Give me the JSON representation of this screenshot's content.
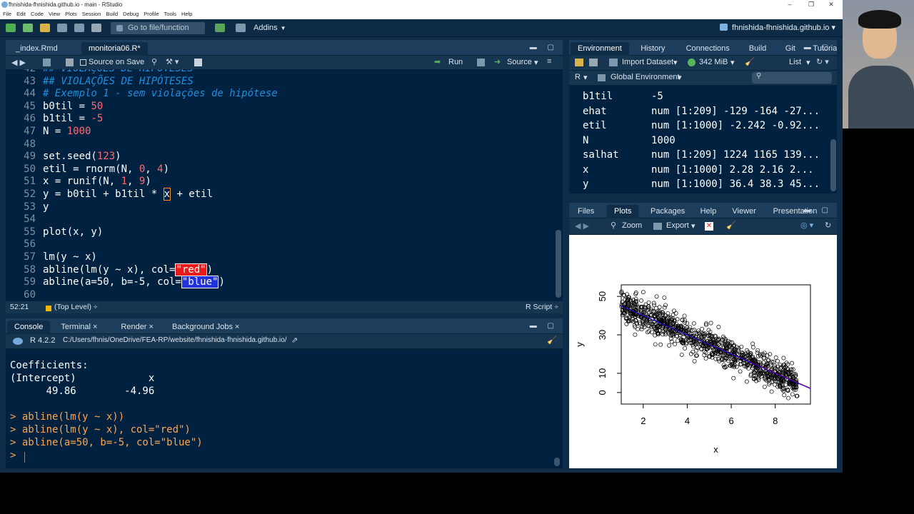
{
  "window": {
    "title": "fhnishida-fhnishida.github.io - main - RStudio",
    "project": "fhnishida-fhnishida.github.io"
  },
  "menu": [
    "File",
    "Edit",
    "Code",
    "View",
    "Plots",
    "Session",
    "Build",
    "Debug",
    "Profile",
    "Tools",
    "Help"
  ],
  "toolbar": {
    "goto": "Go to file/function",
    "addins": "Addins"
  },
  "source_tabs": [
    {
      "label": "_index.Rmd",
      "active": false
    },
    {
      "label": "monitoria06.R*",
      "active": true
    }
  ],
  "source_toolbar": {
    "source_on_save": "Source on Save",
    "run": "Run",
    "source": "Source"
  },
  "code_lines": [
    {
      "n": "42",
      "t": "## VIOLAÇÕES DE HIPÓTESES"
    },
    {
      "n": "43",
      "t": "## VIOLAÇÕES DE HIPÓTESES"
    },
    {
      "n": "44",
      "t": "# Exemplo 1 - sem violações de hipótese"
    },
    {
      "n": "45",
      "a": "b0til = ",
      "b": "50"
    },
    {
      "n": "46",
      "a": "b1til = ",
      "b": "-5"
    },
    {
      "n": "47",
      "a": "N = ",
      "b": "1000"
    },
    {
      "n": "48"
    },
    {
      "n": "49",
      "a": "set.seed(",
      "b": "123",
      "c": ")"
    },
    {
      "n": "50",
      "a": "etil = rnorm(N, ",
      "b": "0",
      "c": ", ",
      "d": "4",
      "e": ")"
    },
    {
      "n": "51",
      "a": "x = runif(N, ",
      "b": "1",
      "c": ", ",
      "d": "9",
      "e": ")"
    },
    {
      "n": "52",
      "a": "y = b0til + b1til * ",
      "x": "x",
      "c": " + etil"
    },
    {
      "n": "53",
      "a": "y"
    },
    {
      "n": "54"
    },
    {
      "n": "55",
      "a": "plot(x, y)"
    },
    {
      "n": "56"
    },
    {
      "n": "57",
      "a": "lm(y ~ x)"
    },
    {
      "n": "58",
      "a": "abline(lm(y ~ x), col=",
      "s": "\"red\"",
      "c": ")"
    },
    {
      "n": "59",
      "a": "abline(a=50, b=-5, col=",
      "s2": "\"blue\"",
      "c": ")"
    },
    {
      "n": "60"
    }
  ],
  "status": {
    "pos": "52:21",
    "scope": "(Top Level) ÷",
    "type": "R Script ÷"
  },
  "console_tabs": [
    "Console",
    "Terminal ×",
    "Render ×",
    "Background Jobs ×"
  ],
  "console_path": {
    "version": "R 4.2.2",
    "path": "C:/Users/fhnis/OneDrive/FEA-RP/website/fhnishida-fhnishida.github.io/"
  },
  "console_lines": [
    "Coefficients:",
    "(Intercept)            x  ",
    "      49.86        -4.96  ",
    "",
    "> abline(lm(y ~ x))",
    "> abline(lm(y ~ x), col=\"red\")",
    "> abline(a=50, b=-5, col=\"blue\")",
    "> "
  ],
  "env_tabs": [
    "Environment",
    "History",
    "Connections",
    "Build",
    "Git",
    "Tutorial"
  ],
  "env_toolbar": {
    "import": "Import Dataset",
    "mem": "342 MiB",
    "list": "List",
    "lang": "R",
    "scope": "Global Environment"
  },
  "env_rows": [
    {
      "name": "b1til",
      "value": "-5"
    },
    {
      "name": "ehat",
      "value": "num [1:209] -129 -164 -27..."
    },
    {
      "name": "etil",
      "value": "num [1:1000] -2.242 -0.92..."
    },
    {
      "name": "N",
      "value": "1000"
    },
    {
      "name": "salhat",
      "value": "num [1:209] 1224 1165 139..."
    },
    {
      "name": "x",
      "value": "num [1:1000] 2.28 2.16 2..."
    },
    {
      "name": "y",
      "value": "num [1:1000] 36.4 38.3 45..."
    }
  ],
  "plot_tabs": [
    "Files",
    "Plots",
    "Packages",
    "Help",
    "Viewer",
    "Presentation"
  ],
  "plot_toolbar": {
    "zoom": "Zoom",
    "export": "Export"
  },
  "chart_data": {
    "type": "scatter",
    "xlabel": "x",
    "ylabel": "y",
    "xlim": [
      1,
      9.6
    ],
    "ylim": [
      -6,
      56
    ],
    "xticks": [
      2,
      4,
      6,
      8
    ],
    "yticks": [
      0,
      10,
      30,
      50
    ],
    "n_points": 1000,
    "model": {
      "intercept": 50,
      "slope": -5,
      "noise_sd": 4,
      "x_min": 1,
      "x_max": 9
    },
    "lines": [
      {
        "intercept": 49.86,
        "slope": -4.96,
        "color": "#000000"
      },
      {
        "intercept": 49.86,
        "slope": -4.96,
        "color": "#ff0000"
      },
      {
        "intercept": 50,
        "slope": -5,
        "color": "#0000ff"
      }
    ]
  }
}
